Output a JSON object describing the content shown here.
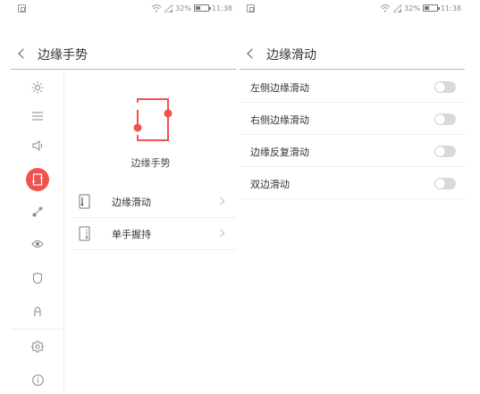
{
  "left_screen": {
    "status": {
      "battery": "32%",
      "time": "11:38"
    },
    "title": "边缘手势",
    "sidebar": {
      "items": [
        {
          "icon": "brightness-icon",
          "active": false
        },
        {
          "icon": "list-icon",
          "active": false
        },
        {
          "icon": "volume-icon",
          "active": false
        },
        {
          "icon": "edge-gesture-icon",
          "active": true
        },
        {
          "icon": "connection-icon",
          "active": false
        },
        {
          "icon": "eye-icon",
          "active": false
        },
        {
          "icon": "shield-icon",
          "active": false
        },
        {
          "icon": "person-icon",
          "active": false
        },
        {
          "icon": "gear-icon",
          "active": false
        },
        {
          "icon": "info-icon",
          "active": false
        }
      ]
    },
    "hero_label": "边缘手势",
    "menu": [
      {
        "label": "边缘滑动",
        "icon": "edge-swipe-icon"
      },
      {
        "label": "单手握持",
        "icon": "one-hand-icon"
      }
    ]
  },
  "right_screen": {
    "status": {
      "battery": "32%",
      "time": "11:38"
    },
    "title": "边缘滑动",
    "settings": [
      {
        "label": "左侧边缘滑动",
        "enabled": false
      },
      {
        "label": "右侧边缘滑动",
        "enabled": false
      },
      {
        "label": "边缘反复滑动",
        "enabled": false
      },
      {
        "label": "双边滑动",
        "enabled": false
      }
    ]
  },
  "colors": {
    "accent": "#ef5350",
    "divider": "#f0a49a",
    "toggle_off": "#d9d9d9"
  }
}
